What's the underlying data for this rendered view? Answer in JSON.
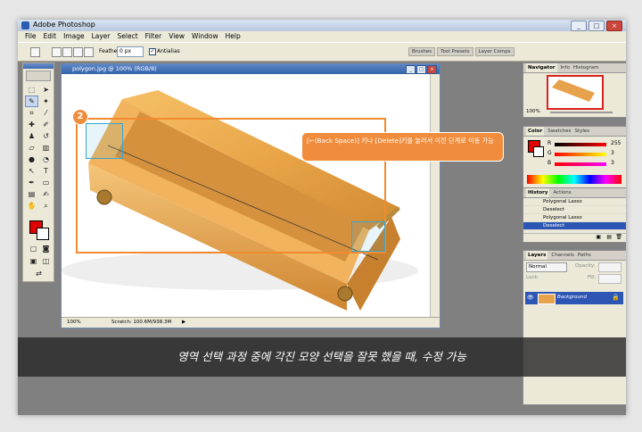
{
  "app": {
    "title": "Adobe Photoshop"
  },
  "window_controls": {
    "minimize": "_",
    "maximize": "□",
    "close": "×"
  },
  "menu": [
    "File",
    "Edit",
    "Image",
    "Layer",
    "Select",
    "Filter",
    "View",
    "Window",
    "Help"
  ],
  "options_bar": {
    "feather_label": "Feather:",
    "feather_value": "0 px",
    "antialias_label": "Antialias",
    "antialias_checked": "✓",
    "panel_tabs": [
      "Brushes",
      "Tool Presets",
      "Layer Comps"
    ]
  },
  "document": {
    "title": "polygon.jpg @ 100% (RGB/8)",
    "zoom": "100%",
    "scratch": "Scratch: 100.6M/938.3M"
  },
  "navigator": {
    "tabs": [
      "Navigator",
      "Info",
      "Histogram"
    ],
    "zoom": "100%"
  },
  "color": {
    "tabs": [
      "Color",
      "Swatches",
      "Styles"
    ],
    "channels": [
      {
        "label": "R",
        "value": "255"
      },
      {
        "label": "G",
        "value": "3"
      },
      {
        "label": "B",
        "value": "3"
      }
    ],
    "foreground": "#e00000"
  },
  "history": {
    "tabs": [
      "History",
      "Actions"
    ],
    "items": [
      "Polygonal Lasso",
      "Deselect",
      "Polygonal Lasso",
      "Deselect"
    ],
    "selected_index": 3
  },
  "layers": {
    "tabs": [
      "Layers",
      "Channels",
      "Paths"
    ],
    "blend_mode": "Normal",
    "opacity_label": "Opacity:",
    "lock_label": "Lock:",
    "fill_label": "Fill:",
    "layer_name": "Background"
  },
  "annotation": {
    "step": "2",
    "tooltip": "[←(Back Space)] 키나 [Delete]키를 눌러서 이전 단계로 이동 가능"
  },
  "caption": "영역 선택 과정 중에 각진 모양 선택을 잘못 했을 때, 수정 가능"
}
